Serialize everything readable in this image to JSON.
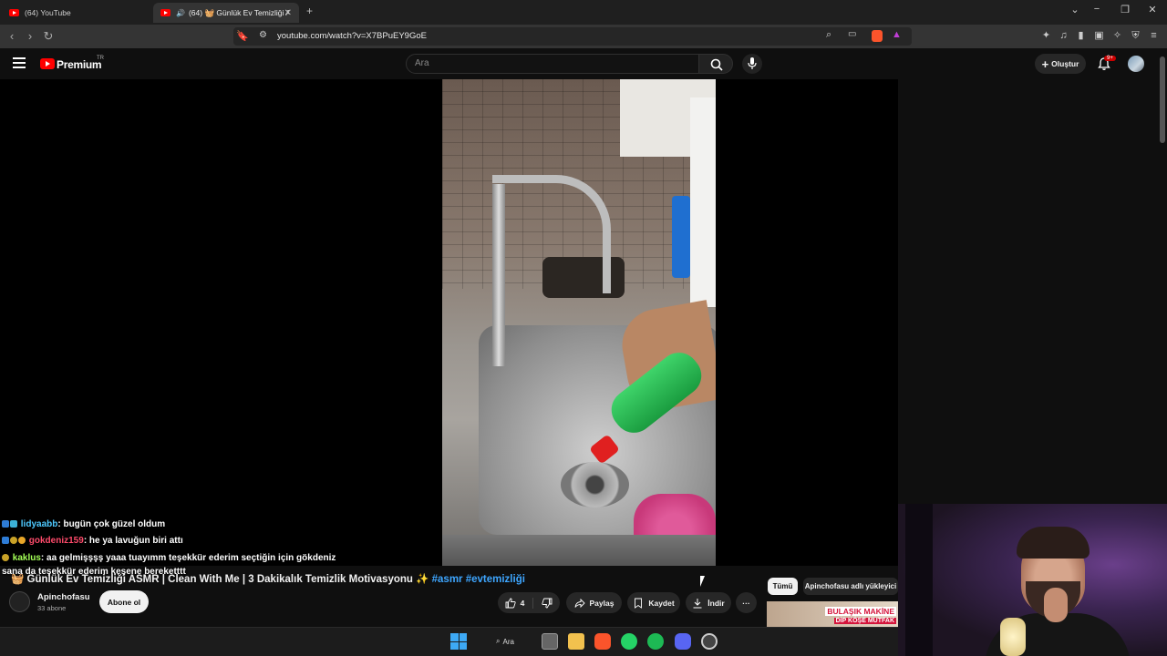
{
  "browser": {
    "tabs": [
      {
        "label": "(64) YouTube"
      },
      {
        "label": "(64) 🧺 Günlük Ev Temizliği A"
      }
    ],
    "new_tab": "+",
    "url": "youtube.com/watch?v=X7BPuEY9GoE",
    "window_controls": [
      "⌄",
      "−",
      "❐",
      "✕"
    ]
  },
  "youtube": {
    "brand": "Premium",
    "region": "TR",
    "search_placeholder": "Ara",
    "create_label": "Oluştur",
    "notification_count": "9+"
  },
  "chat": [
    {
      "user": "lidyaabb",
      "message": ": bugün çok güzel oldum",
      "user_color": "#4ec9ff"
    },
    {
      "user": "gokdeniz159",
      "message": ": he ya lavuğun biri attı",
      "user_color": "#ff4b6b"
    },
    {
      "user": "kaklus",
      "message": ": aa gelmişşşş yaaa tuayımm teşekkür ederim seçtiğin için gökdeniz",
      "user_color": "#a4ff57"
    },
    {
      "user": "",
      "message": "sana da teşekkür ederim keşene bereketttt",
      "user_color": "#ffffff"
    }
  ],
  "video": {
    "title": "🧺 Günlük Ev Temizliği ASMR | Clean With Me | 3 Dakikalık Temizlik Motivasyonu ✨",
    "hashtags": "#asmr #evtemizliği",
    "channel": "Apinchofasu",
    "subscribers": "33 abone",
    "subscribe_label": "Abone ol",
    "like_count": "4",
    "share_label": "Paylaş",
    "save_label": "Kaydet",
    "download_label": "İndir",
    "more_label": "···"
  },
  "recommendations": {
    "chip_all": "Tümü",
    "chip_uploader": "Apinchofasu adlı yükleyici",
    "thumb_line1": "BULAŞIK MAKİNE",
    "thumb_line2": "DİP KÖŞE MUTFAK"
  },
  "taskbar": {
    "search_label": "Ara"
  },
  "colors": {
    "accent": "#ff0000",
    "hashtag": "#3ea6ff",
    "background": "#0f0f0f"
  }
}
